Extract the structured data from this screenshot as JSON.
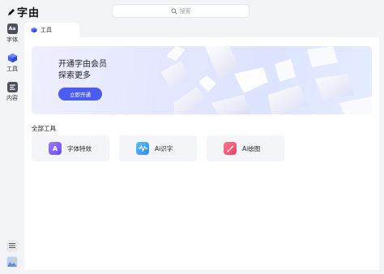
{
  "app": {
    "logo_text": "字由"
  },
  "search": {
    "placeholder": "搜索"
  },
  "sidebar": {
    "items": [
      {
        "label": "字体",
        "icon": "font-icon"
      },
      {
        "label": "工具",
        "icon": "cube-icon"
      },
      {
        "label": "内容",
        "icon": "content-icon"
      }
    ],
    "bottom": [
      {
        "icon": "menu-icon"
      },
      {
        "icon": "avatar-icon"
      }
    ]
  },
  "tabs": [
    {
      "label": "工具"
    }
  ],
  "banner": {
    "title_line1": "开通字由会员",
    "title_line2": "探索更多",
    "cta": "立即开通"
  },
  "tools": {
    "section_title": "全部工具",
    "items": [
      {
        "label": "字体特效",
        "icon": "font-effect-icon",
        "color": "#7a5cf5"
      },
      {
        "label": "Ai识字",
        "icon": "waveform-icon",
        "color": "#2f9bf0"
      },
      {
        "label": "Ai绘图",
        "icon": "brush-icon",
        "color": "#ee4f6f"
      }
    ]
  },
  "colors": {
    "accent": "#4b5cf0",
    "sidebar_active": "#4a6cf7"
  }
}
